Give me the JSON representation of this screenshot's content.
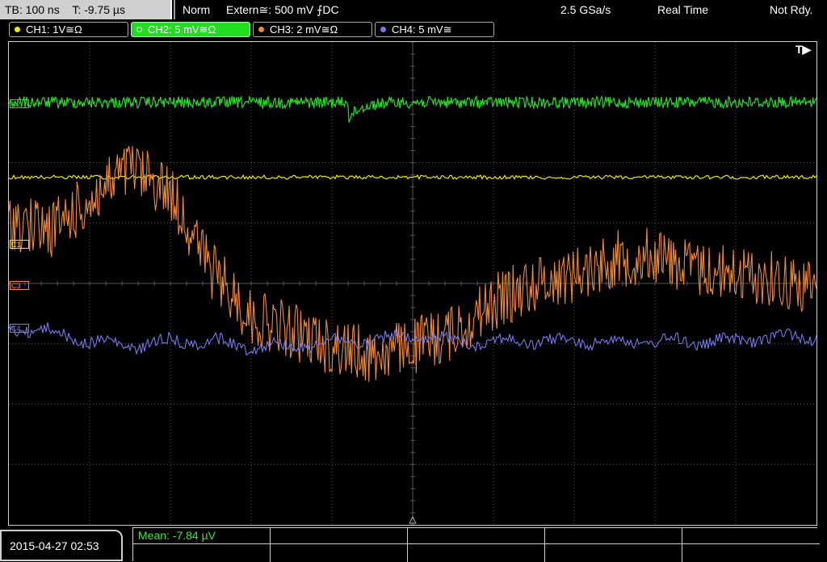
{
  "topbar": {
    "timebase": "TB: 100 ns",
    "trigger_time": "T: -9.75 µs",
    "mode": "Norm",
    "trigger_source": "Extern≅: 500 mV ⨍DC",
    "sample_rate": "2.5 GSa/s",
    "acq_mode": "Real Time",
    "status": "Not Rdy."
  },
  "channels": [
    {
      "label": "CH1: 1V≅Ω",
      "color": "#f2e600"
    },
    {
      "label": "CH2: 5 mV≅Ω",
      "color": "#22dd22"
    },
    {
      "label": "CH3: 2 mV≅Ω",
      "color": "#f28a30"
    },
    {
      "label": "CH4: 5 mV≅",
      "color": "#7777ee"
    }
  ],
  "channel_markers": {
    "c1": "C1",
    "c2": "C2",
    "c3": "C3",
    "c4": "C4"
  },
  "trigger_marker": "T▶",
  "bottom": {
    "datetime": "2015-04-27  02:53",
    "mean": "Mean: -7.84 µV"
  },
  "colors": {
    "grid": "#555555",
    "frame": "#cfcfcf",
    "ch1": "#f2e600",
    "ch2": "#22dd22",
    "ch3": "#f28a30",
    "ch4": "#7777ee"
  },
  "waveforms": {
    "ch1": {
      "level": 0.28,
      "noise": 0.004
    },
    "ch2": {
      "level": 0.125,
      "noise": 0.012,
      "glitch_at": 0.42
    },
    "ch3": {
      "baseline": [
        0.37,
        0.39,
        0.33,
        0.26,
        0.31,
        0.47,
        0.57,
        0.6,
        0.63,
        0.65,
        0.63,
        0.6,
        0.54,
        0.5,
        0.48,
        0.45,
        0.44,
        0.47,
        0.48,
        0.49,
        0.51
      ],
      "noise": 0.06
    },
    "ch4": {
      "baseline": [
        0.59,
        0.6,
        0.62,
        0.63,
        0.62,
        0.62,
        0.63,
        0.63,
        0.62,
        0.62,
        0.61,
        0.62,
        0.62,
        0.62,
        0.62,
        0.62,
        0.62,
        0.62,
        0.62,
        0.61,
        0.61
      ],
      "noise": 0.012
    }
  }
}
